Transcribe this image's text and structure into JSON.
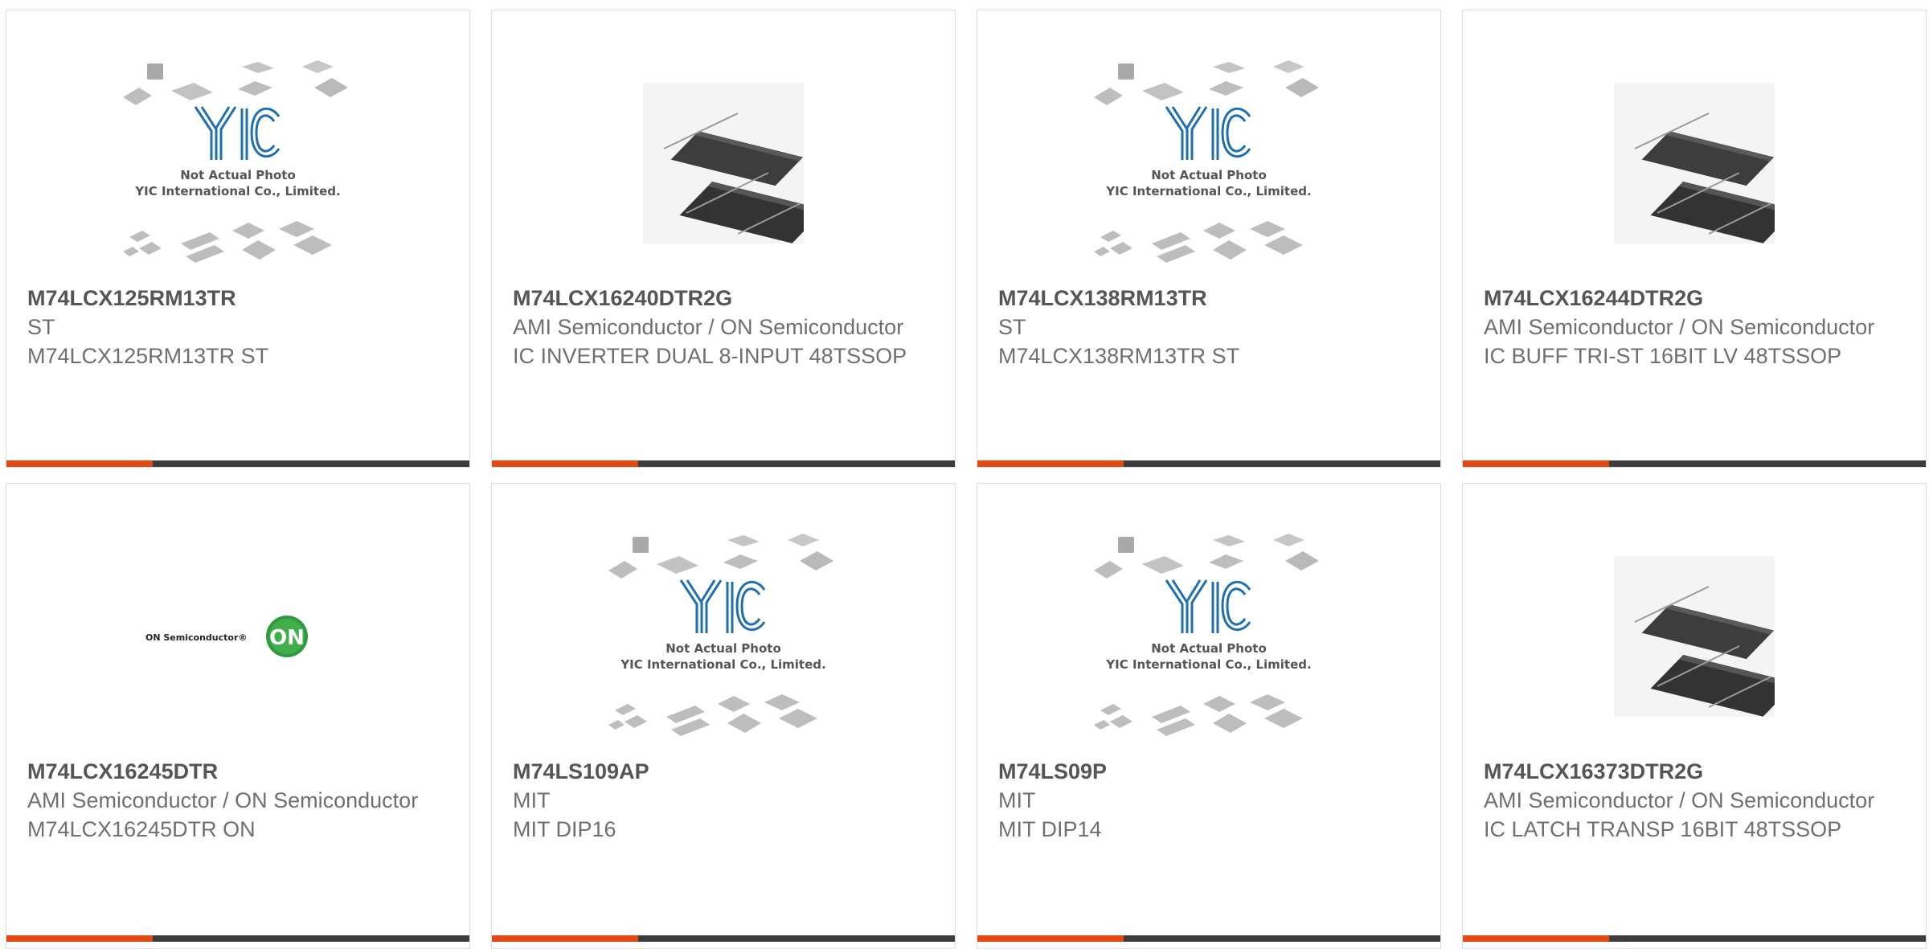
{
  "placeholder": {
    "line1": "Not Actual Photo",
    "line2": "YIC International Co., Limited.",
    "logo": "YIC"
  },
  "on_logo": {
    "text": "ON Semiconductor®",
    "mark": "ON"
  },
  "colors": {
    "accent": "#e34a12",
    "bar": "#3c3c3c",
    "yic_blue": "#1f6fb0",
    "on_green": "#2f9a3d"
  },
  "products": [
    {
      "part": "M74LCX125RM13TR",
      "maker": "ST",
      "desc": "M74LCX125RM13TR ST",
      "image": "placeholder"
    },
    {
      "part": "M74LCX16240DTR2G",
      "maker": "AMI Semiconductor / ON Semiconductor",
      "desc": "IC INVERTER DUAL 8-INPUT 48TSSOP",
      "image": "tssop-chip"
    },
    {
      "part": "M74LCX138RM13TR",
      "maker": "ST",
      "desc": "M74LCX138RM13TR ST",
      "image": "placeholder"
    },
    {
      "part": "M74LCX16244DTR2G",
      "maker": "AMI Semiconductor / ON Semiconductor",
      "desc": "IC BUFF TRI-ST 16BIT LV 48TSSOP",
      "image": "tssop-chip"
    },
    {
      "part": "M74LCX16245DTR",
      "maker": "AMI Semiconductor / ON Semiconductor",
      "desc": "M74LCX16245DTR ON",
      "image": "on-logo"
    },
    {
      "part": "M74LS109AP",
      "maker": "MIT",
      "desc": "MIT DIP16",
      "image": "placeholder"
    },
    {
      "part": "M74LS09P",
      "maker": "MIT",
      "desc": "MIT DIP14",
      "image": "placeholder"
    },
    {
      "part": "M74LCX16373DTR2G",
      "maker": "AMI Semiconductor / ON Semiconductor",
      "desc": "IC LATCH TRANSP 16BIT 48TSSOP",
      "image": "tssop-chip"
    }
  ]
}
